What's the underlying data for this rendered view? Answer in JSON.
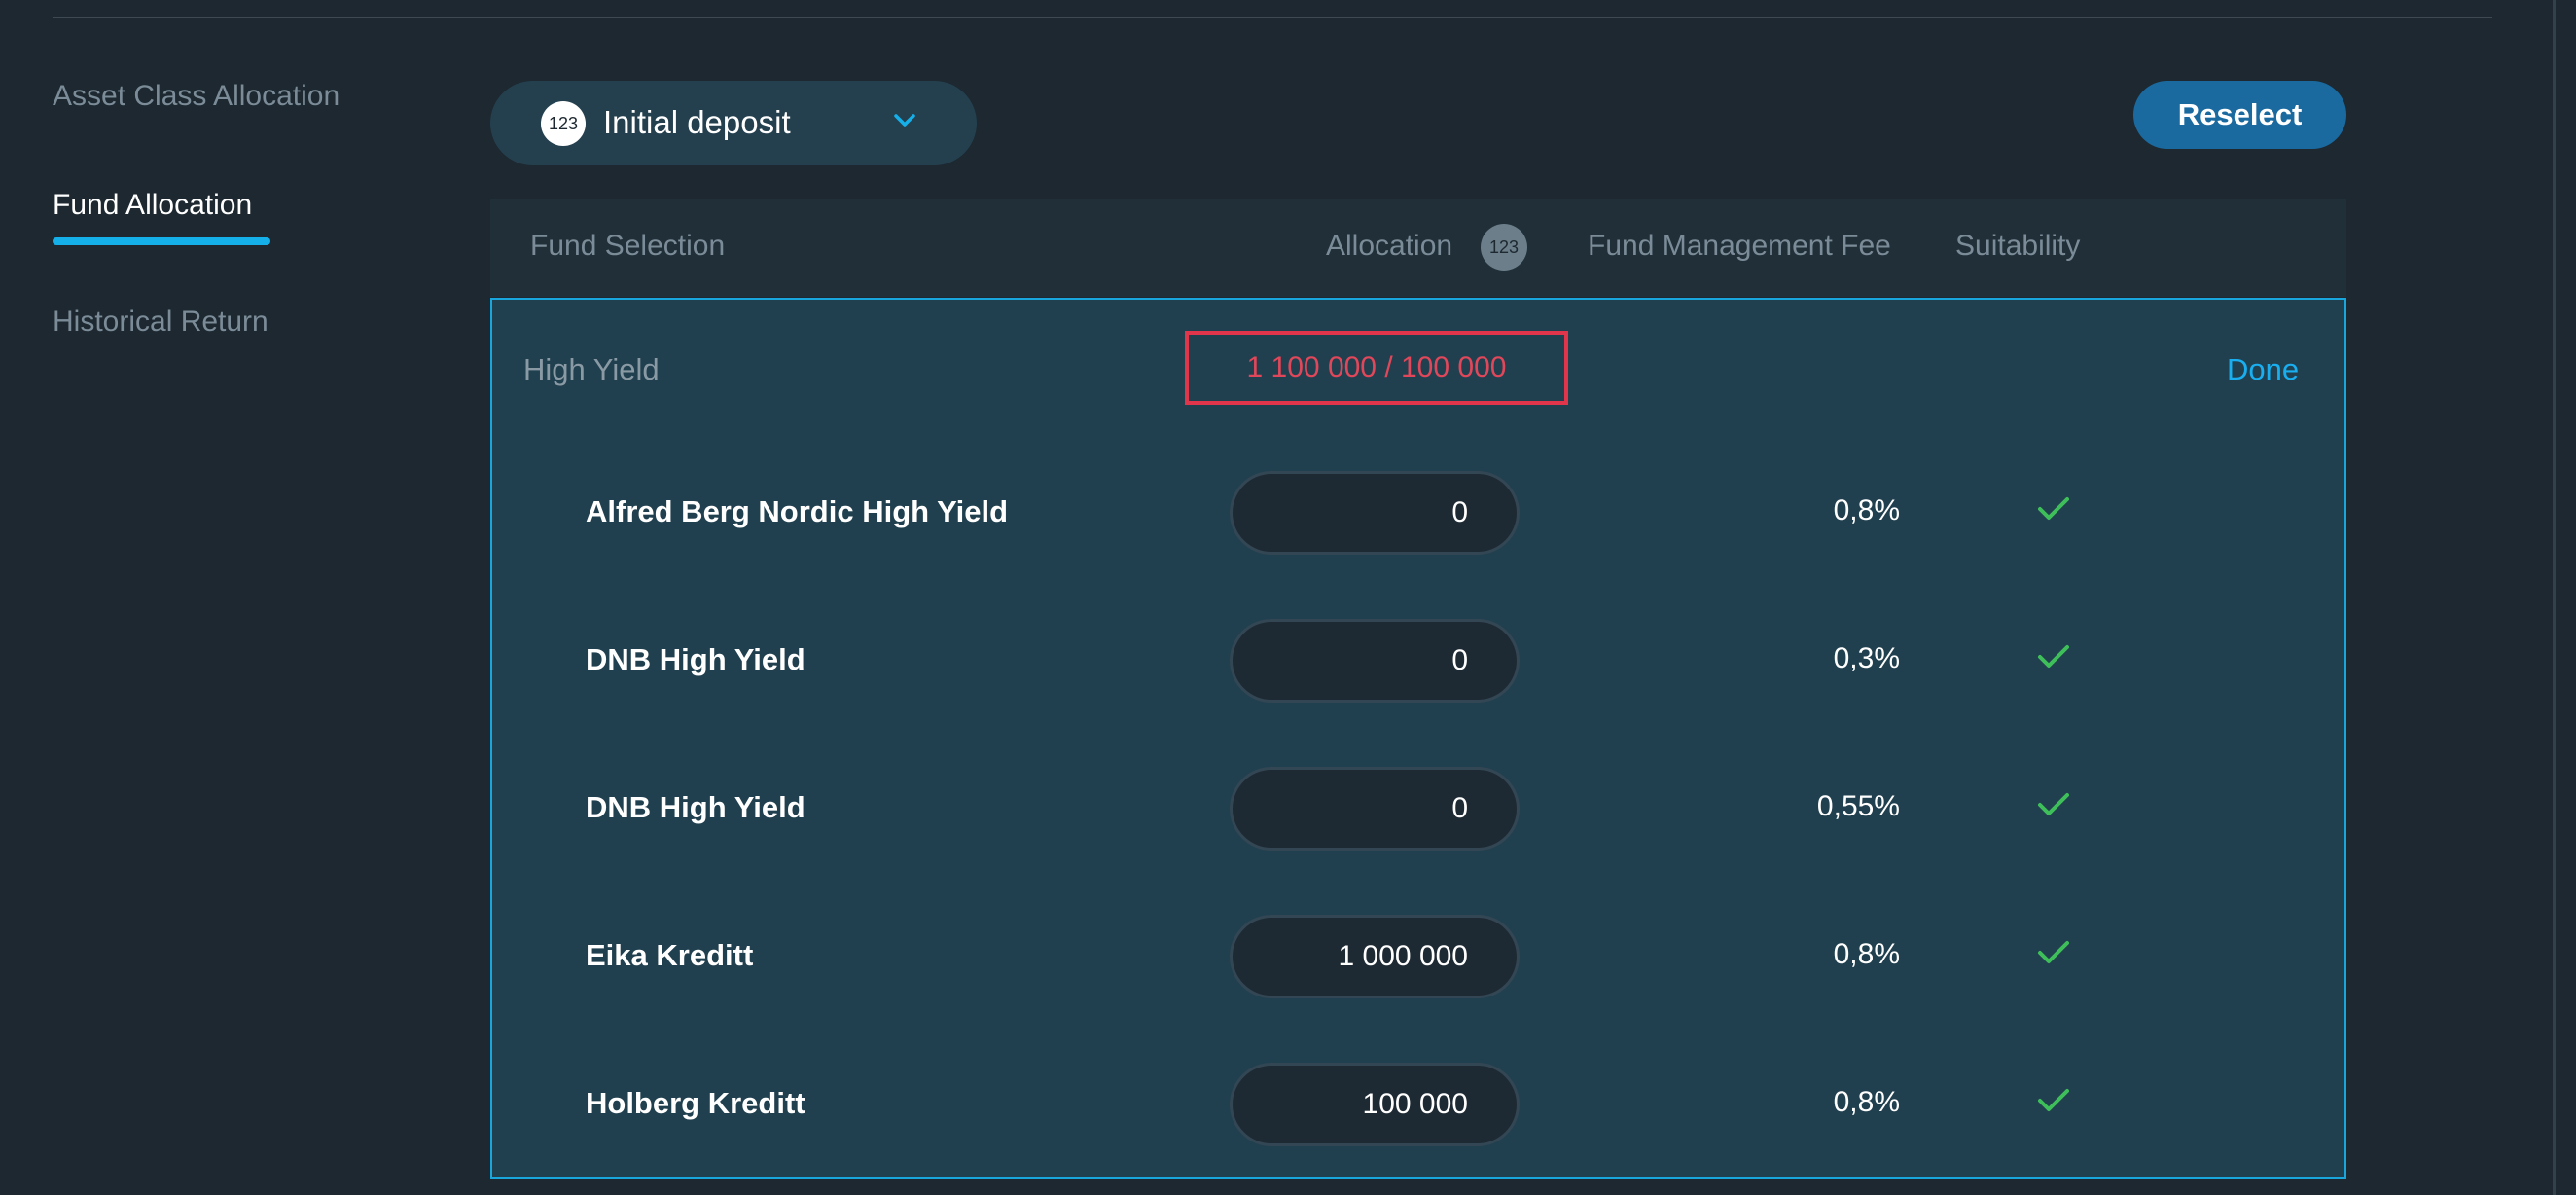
{
  "sidebar": {
    "items": [
      {
        "label": "Asset Class Allocation",
        "active": false
      },
      {
        "label": "Fund Allocation",
        "active": true
      },
      {
        "label": "Historical Return",
        "active": false
      }
    ]
  },
  "deposit": {
    "badge": "123",
    "label": "Initial deposit"
  },
  "reselect_label": "Reselect",
  "table": {
    "headers": {
      "fund": "Fund Selection",
      "allocation": "Allocation",
      "allocation_badge": "123",
      "fee": "Fund Management Fee",
      "suitability": "Suitability"
    },
    "group": {
      "name": "High Yield",
      "total": "1 100 000 / 100 000",
      "done_label": "Done"
    },
    "rows": [
      {
        "name": "Alfred Berg Nordic High Yield",
        "allocation": "0",
        "fee": "0,8%",
        "suitable": true
      },
      {
        "name": "DNB High Yield",
        "allocation": "0",
        "fee": "0,3%",
        "suitable": true
      },
      {
        "name": "DNB High Yield",
        "allocation": "0",
        "fee": "0,55%",
        "suitable": true
      },
      {
        "name": "Eika Kreditt",
        "allocation": "1 000 000",
        "fee": "0,8%",
        "suitable": true
      },
      {
        "name": "Holberg Kreditt",
        "allocation": "100 000",
        "fee": "0,8%",
        "suitable": true
      }
    ]
  },
  "colors": {
    "background": "#1d2830",
    "accent": "#15b0ea",
    "error": "#e0354a",
    "success": "#3fbf5a",
    "button": "#1a6aa0"
  },
  "icons": {
    "dropdown": "chevron-down-icon",
    "suitability": "check-icon"
  }
}
